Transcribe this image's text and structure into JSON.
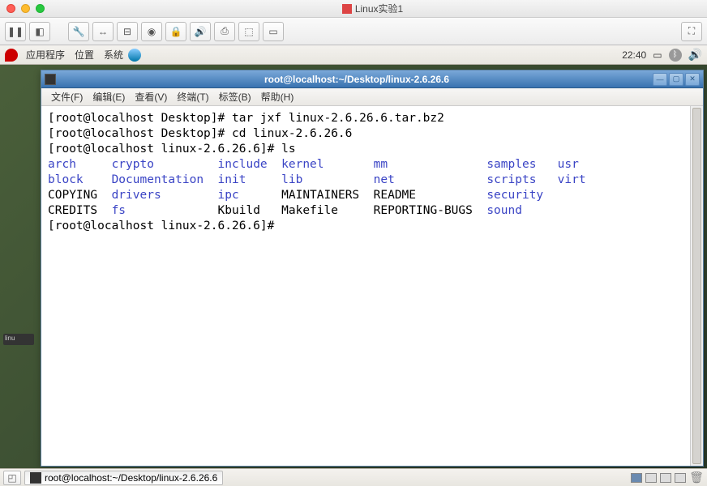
{
  "mac_title": "Linux实验1",
  "gnome_menus": {
    "apps": "应用程序",
    "places": "位置",
    "system": "系统"
  },
  "clock": "22:40",
  "term_title": "root@localhost:~/Desktop/linux-2.6.26.6",
  "term_menus": {
    "file": "文件(F)",
    "edit": "编辑(E)",
    "view": "查看(V)",
    "terminal": "终端(T)",
    "tabs": "标签(B)",
    "help": "帮助(H)"
  },
  "terminal": {
    "prompt1": "[root@localhost Desktop]# ",
    "cmd1": "tar jxf linux-2.6.26.6.tar.bz2",
    "prompt2": "[root@localhost Desktop]# ",
    "cmd2": "cd linux-2.6.26.6",
    "prompt3": "[root@localhost linux-2.6.26.6]# ",
    "cmd3": "ls",
    "row1": {
      "c1": "arch",
      "c2": "crypto",
      "c3": "include",
      "c4": "kernel",
      "c5": "mm",
      "c6": "samples",
      "c7": "usr"
    },
    "row2": {
      "c1": "block",
      "c2": "Documentation",
      "c3": "init",
      "c4": "lib",
      "c5": "net",
      "c6": "scripts",
      "c7": "virt"
    },
    "row3": {
      "c1": "COPYING",
      "c2": "drivers",
      "c3": "ipc",
      "c4": "MAINTAINERS",
      "c5": "README",
      "c6": "security"
    },
    "row4": {
      "c1": "CREDITS",
      "c2": "fs",
      "c3": "Kbuild",
      "c4": "Makefile",
      "c5": "REPORTING-BUGS",
      "c6": "sound"
    },
    "prompt4": "[root@localhost linux-2.6.26.6]# "
  },
  "taskbar_item": "root@localhost:~/Desktop/linux-2.6.26.6",
  "dock_thumb": "linu"
}
